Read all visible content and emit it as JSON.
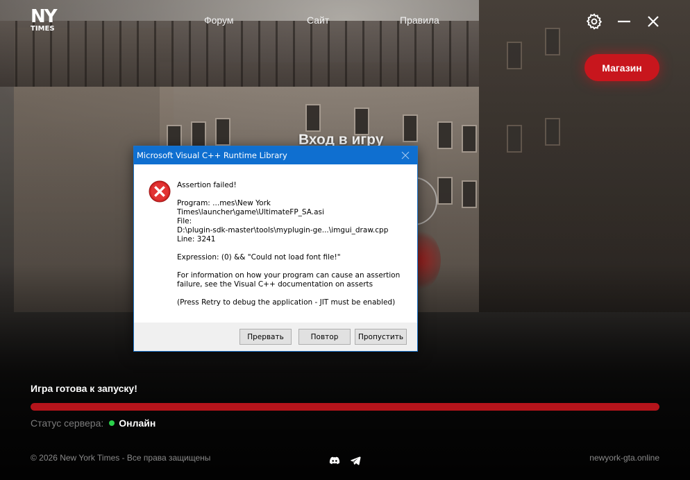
{
  "header": {
    "logo_top": "NY",
    "logo_bottom": "TIMES",
    "nav": {
      "forum": "Форум",
      "site": "Сайт",
      "rules": "Правила"
    },
    "shop_label": "Магазин"
  },
  "main": {
    "login_title": "Вход в игру"
  },
  "dialog": {
    "title": "Microsoft Visual C++ Runtime Library",
    "lines": {
      "assertion": "Assertion failed!",
      "program1": "Program: ...mes\\New York",
      "program2": "Times\\launcher\\game\\UltimateFP_SA.asi",
      "file1": "File:",
      "file2": "D:\\plugin-sdk-master\\tools\\myplugin-ge...\\imgui_draw.cpp",
      "line": "Line: 3241",
      "expression": "Expression: (0) && \"Could not load font file!\"",
      "info1": "For information on how your program can cause an assertion",
      "info2": "failure, see the Visual C++ documentation on asserts",
      "retry_hint": "(Press Retry to debug the application - JIT must be enabled)"
    },
    "buttons": {
      "abort": "Прервать",
      "retry": "Повтор",
      "ignore": "Пропустить"
    }
  },
  "status": {
    "ready_text": "Игра готова к запуску!",
    "progress_percent": 100,
    "server_label": "Статус сервера:",
    "server_value": "Онлайн",
    "online_color": "#2bd14b",
    "accent_color": "#c8161d"
  },
  "footer": {
    "copyright": "© 2026 New York Times - Все права защищены",
    "site_url": "newyork-gta.online",
    "social_icons": [
      "discord-icon",
      "telegram-icon"
    ]
  }
}
